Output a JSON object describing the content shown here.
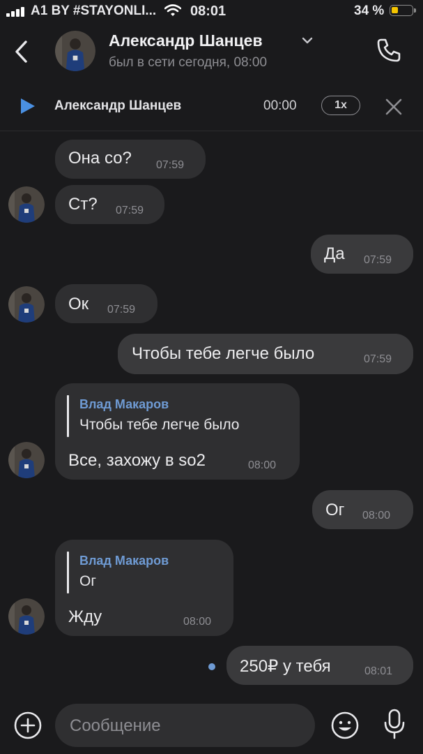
{
  "status_bar": {
    "carrier": "A1 BY #STAYONLI...",
    "time": "08:01",
    "battery_percent": "34 %",
    "battery_level": 0.34
  },
  "header": {
    "name": "Александр Шанцев",
    "status": "был в сети сегодня, 08:00"
  },
  "audio_player": {
    "title": "Александр Шанцев",
    "time": "00:00",
    "speed": "1x"
  },
  "messages": [
    {
      "direction": "in",
      "text": "Она со?",
      "time": "07:59"
    },
    {
      "direction": "in",
      "text": "Ст?",
      "time": "07:59"
    },
    {
      "direction": "out",
      "text": "Да",
      "time": "07:59"
    },
    {
      "direction": "in",
      "text": "Ок",
      "time": "07:59"
    },
    {
      "direction": "out",
      "text": "Чтобы тебе легче было",
      "time": "07:59"
    },
    {
      "direction": "in",
      "reply_author": "Влад Макаров",
      "reply_text": "Чтобы тебе легче было",
      "text": "Все, захожу в so2",
      "time": "08:00"
    },
    {
      "direction": "out",
      "text": "Ог",
      "time": "08:00"
    },
    {
      "direction": "in",
      "reply_author": "Влад Макаров",
      "reply_text": "Ог",
      "text": "Жду",
      "time": "08:00"
    },
    {
      "direction": "out",
      "text": "250₽ у тебя",
      "time": "08:01",
      "unread": true
    }
  ],
  "composer": {
    "placeholder": "Сообщение"
  },
  "colors": {
    "background": "#1a1a1c",
    "bubble_in": "#2f2f31",
    "bubble_out": "#3a3a3c",
    "accent": "#6f9bd4",
    "play": "#4a90e2",
    "battery": "#f5c500"
  }
}
